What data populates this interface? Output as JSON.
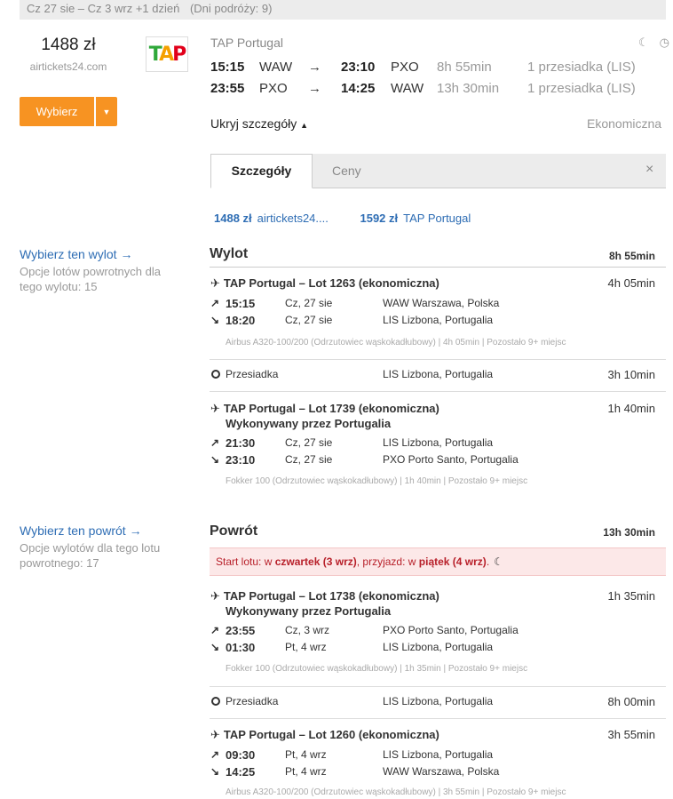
{
  "topbar": {
    "dates": "Cz 27 sie – Cz 3 wrz +1 dzień",
    "trip_days": "(Dni podróży: 9)"
  },
  "offer": {
    "price": "1488 zł",
    "site": "airtickets24.com",
    "select_label": "Wybierz",
    "select_caret": "▼",
    "logo_letters": [
      "T",
      "A",
      "P"
    ]
  },
  "airline": "TAP Portugal",
  "icons": {
    "moon": "moon-icon",
    "clock": "clock-icon",
    "close": "close-icon",
    "plane": "plane-icon",
    "depart": "depart-arrow-icon",
    "arrive": "arrive-arrow-icon"
  },
  "routes": [
    {
      "dep_time": "15:15",
      "dep_code": "WAW",
      "arrow": "→",
      "arr_time": "23:10",
      "arr_code": "PXO",
      "duration": "8h 55min",
      "stops": "1 przesiadka (LIS)"
    },
    {
      "dep_time": "23:55",
      "dep_code": "PXO",
      "arrow": "→",
      "arr_time": "14:25",
      "arr_code": "WAW",
      "duration": "13h 30min",
      "stops": "1 przesiadka (LIS)"
    }
  ],
  "details": {
    "hide_label": "Ukryj szczegóły",
    "cabin": "Ekonomiczna"
  },
  "tabs": {
    "details": "Szczegóły",
    "prices": "Ceny",
    "close": "×"
  },
  "offers": [
    {
      "price": "1488 zł",
      "seller": "airtickets24...."
    },
    {
      "price": "1592 zł",
      "seller": "TAP Portugal"
    }
  ],
  "outbound": {
    "side_link": "Wybierz ten wylot →",
    "side_note": "Opcje lotów powrotnych dla tego wylotu: 15",
    "title": "Wylot",
    "duration": "8h 55min",
    "flights": [
      {
        "title": "TAP Portugal – Lot 1263 (ekonomiczna)",
        "duration": "4h 05min",
        "dep": {
          "dir": "↗",
          "time": "15:15",
          "date": "Cz, 27 sie",
          "airport": "WAW Warszawa, Polska"
        },
        "arr": {
          "dir": "↘",
          "time": "18:20",
          "date": "Cz, 27 sie",
          "airport": "LIS Lizbona, Portugalia"
        },
        "meta": "Airbus A320-100/200 (Odrzutowiec wąskokadłubowy)  |  4h 05min  |  Pozostało 9+ miejsc"
      },
      {
        "title": "TAP Portugal – Lot 1739 (ekonomiczna)",
        "operated": "Wykonywany przez Portugalia",
        "duration": "1h 40min",
        "dep": {
          "dir": "↗",
          "time": "21:30",
          "date": "Cz, 27 sie",
          "airport": "LIS Lizbona, Portugalia"
        },
        "arr": {
          "dir": "↘",
          "time": "23:10",
          "date": "Cz, 27 sie",
          "airport": "PXO Porto Santo, Portugalia"
        },
        "meta": "Fokker 100 (Odrzutowiec wąskokadłubowy)  |  1h 40min  |  Pozostało 9+ miejsc"
      }
    ],
    "transfer": {
      "label": "Przesiadka",
      "location": "LIS Lizbona, Portugalia",
      "duration": "3h 10min"
    }
  },
  "inbound": {
    "side_link": "Wybierz ten powrót →",
    "side_note": "Opcje wylotów dla tego lotu powrotnego: 17",
    "title": "Powrót",
    "duration": "13h 30min",
    "banner": {
      "p1": "Start lotu: w ",
      "day1": "czwartek (3 wrz)",
      "p2": ", przyjazd: w ",
      "day2": "piątek (4 wrz)",
      "p3": "."
    },
    "flights": [
      {
        "title": "TAP Portugal – Lot 1738 (ekonomiczna)",
        "operated": "Wykonywany przez Portugalia",
        "duration": "1h 35min",
        "dep": {
          "dir": "↗",
          "time": "23:55",
          "date": "Cz, 3 wrz",
          "airport": "PXO Porto Santo, Portugalia"
        },
        "arr": {
          "dir": "↘",
          "time": "01:30",
          "date": "Pt, 4 wrz",
          "airport": "LIS Lizbona, Portugalia"
        },
        "meta": "Fokker 100 (Odrzutowiec wąskokadłubowy)  |  1h 35min  |  Pozostało 9+ miejsc"
      },
      {
        "title": "TAP Portugal – Lot 1260 (ekonomiczna)",
        "duration": "3h 55min",
        "dep": {
          "dir": "↗",
          "time": "09:30",
          "date": "Pt, 4 wrz",
          "airport": "LIS Lizbona, Portugalia"
        },
        "arr": {
          "dir": "↘",
          "time": "14:25",
          "date": "Pt, 4 wrz",
          "airport": "WAW Warszawa, Polska"
        },
        "meta": "Airbus A320-100/200 (Odrzutowiec wąskokadłubowy)  |  3h 55min  |  Pozostało 9+ miejsc"
      }
    ],
    "transfer": {
      "label": "Przesiadka",
      "location": "LIS Lizbona, Portugalia",
      "duration": "8h 00min"
    }
  }
}
